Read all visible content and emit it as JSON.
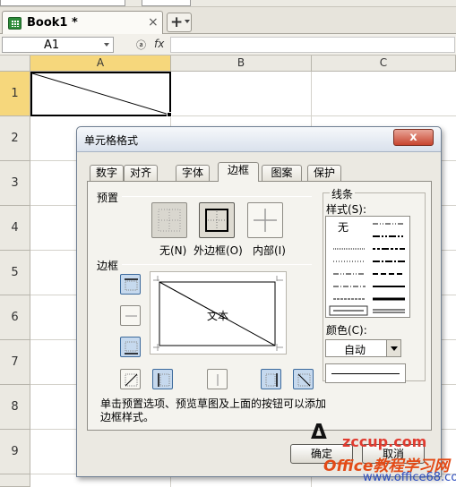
{
  "workbook_tab": {
    "title": "Book1 *",
    "close": "×"
  },
  "new_tab": {
    "plus": "+"
  },
  "formula_bar": {
    "name_box": "A1",
    "fx": "fx"
  },
  "columns": [
    "A",
    "B",
    "C"
  ],
  "rows": [
    "1",
    "2",
    "3",
    "4",
    "5",
    "6",
    "7",
    "8",
    "9"
  ],
  "dialog": {
    "title": "单元格格式",
    "close": "x",
    "tabs": [
      "数字",
      "对齐",
      "字体",
      "边框",
      "图案",
      "保护"
    ],
    "active_tab": "边框",
    "presets_label": "预置",
    "presets": [
      "无(N)",
      "外边框(O)",
      "内部(I)"
    ],
    "border_label": "边框",
    "preview_text": "文本",
    "hint": "单击预置选项、预览草图及上面的按钮可以添加边框样式。",
    "line_group": "线条",
    "style_label": "样式(S):",
    "style_none": "无",
    "color_label": "颜色(C):",
    "color_value": "自动",
    "ok": "确定",
    "cancel": "取消"
  },
  "watermark": {
    "logo": "Δ",
    "url1": "zccup.com",
    "brand": "Office教程学习网",
    "url2": "www.office68.com"
  }
}
